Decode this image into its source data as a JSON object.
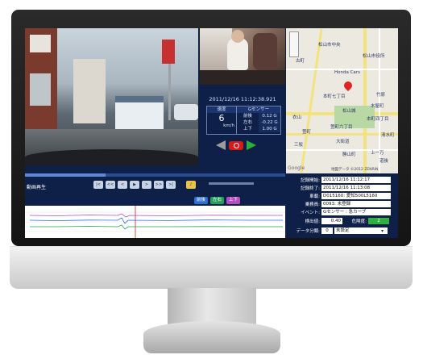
{
  "telemetry": {
    "timestamp": "2011/12/16  11:12:38.921",
    "speed_label": "速度",
    "speed_value": "6",
    "speed_unit": "km/h",
    "gsensor_label": "Gセンサー",
    "g_rows": [
      {
        "axis": "前後",
        "value": "0.12 G"
      },
      {
        "axis": "左右",
        "value": "-0.22 G"
      },
      {
        "axis": "上下",
        "value": "1.00 G"
      }
    ]
  },
  "controls": {
    "play_label": "動画再生",
    "progress": 0.31,
    "mode_buttons": [
      "前後",
      "左右",
      "上下"
    ]
  },
  "info": {
    "rows": [
      {
        "label": "記録開始:",
        "value": "2011/12/16 11:12:17"
      },
      {
        "label": "記録終了:",
        "value": "2011/12/16 11:13:08"
      },
      {
        "label": "車載:",
        "value": "D015160: 愛知500L5160"
      },
      {
        "label": "乗務員:",
        "value": "0093: 未登録"
      },
      {
        "label": "イベント:",
        "value": "Gセンサー : 急カーブ"
      }
    ],
    "detect_label": "検出値:",
    "detect_value": "0.40",
    "level_label": "危険度:",
    "level_value": "2",
    "classify_label": "データ分類:",
    "classify_value": "0",
    "classify_text": "未設定"
  },
  "map": {
    "labels": [
      "松山市中央",
      "松山市役所",
      "Honda Cars",
      "本町七丁目",
      "木屋町",
      "衣山",
      "萱町六丁目",
      "本町四丁目",
      "清水町",
      "松山城",
      "三坂",
      "上一万",
      "大街道",
      "勝山町",
      "道後",
      "竹原",
      "萱町",
      "古町"
    ],
    "copyright": "地図データ ©2012 ZENRIN",
    "google": "Google"
  },
  "colors": {
    "accent": "#2e6fcf",
    "panel": "#0e2048"
  }
}
